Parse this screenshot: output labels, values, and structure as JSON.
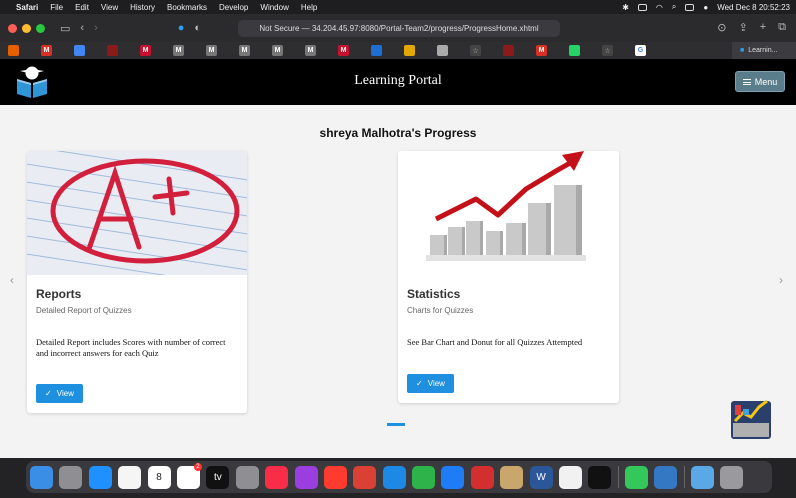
{
  "menubar": {
    "apple": "",
    "items": [
      "Safari",
      "File",
      "Edit",
      "View",
      "History",
      "Bookmarks",
      "Develop",
      "Window",
      "Help"
    ],
    "datetime": "Wed Dec 8  20:52:23"
  },
  "browser": {
    "address": "Not Secure — 34.204.45.97:8080/Portal-Team2/progress/ProgressHome.xhtml",
    "active_tab": "Learnin..."
  },
  "favorites": [
    {
      "icon": "firefox-icon",
      "color": "#e66000",
      "glyph": ""
    },
    {
      "icon": "gmail-icon",
      "color": "#d93025",
      "glyph": "M"
    },
    {
      "icon": "docs-icon",
      "color": "#4285f4",
      "glyph": ""
    },
    {
      "icon": "site-icon",
      "color": "#8b1a1a",
      "glyph": ""
    },
    {
      "icon": "mcgraw-icon",
      "color": "#c8102e",
      "glyph": "M"
    },
    {
      "icon": "m-icon",
      "color": "#777",
      "glyph": "M"
    },
    {
      "icon": "m-icon",
      "color": "#777",
      "glyph": "M"
    },
    {
      "icon": "m-icon",
      "color": "#777",
      "glyph": "M"
    },
    {
      "icon": "m-icon",
      "color": "#777",
      "glyph": "M"
    },
    {
      "icon": "m-icon",
      "color": "#777",
      "glyph": "M"
    },
    {
      "icon": "mcgraw-icon",
      "color": "#c8102e",
      "glyph": "M"
    },
    {
      "icon": "learn-icon",
      "color": "#1d6fd6",
      "glyph": ""
    },
    {
      "icon": "hazard-icon",
      "color": "#e0a800",
      "glyph": ""
    },
    {
      "icon": "tool-icon",
      "color": "#aaa",
      "glyph": ""
    },
    {
      "icon": "star-icon",
      "color": "#444",
      "glyph": "☆"
    },
    {
      "icon": "site-icon",
      "color": "#8b1a1a",
      "glyph": ""
    },
    {
      "icon": "gmail-icon",
      "color": "#d93025",
      "glyph": "M"
    },
    {
      "icon": "whatsapp-icon",
      "color": "#25d366",
      "glyph": ""
    },
    {
      "icon": "star-icon",
      "color": "#444",
      "glyph": "☆"
    },
    {
      "icon": "google-icon",
      "color": "#fff",
      "glyph": "G"
    }
  ],
  "page": {
    "brand": "Learning Portal",
    "menu_label": "Menu",
    "heading": "shreya Malhotra's Progress",
    "cards": [
      {
        "title": "Reports",
        "subtitle": "Detailed Report of Quizzes",
        "text": "Detailed Report includes Scores with number of correct and incorrect answers for each Quiz",
        "button": "View"
      },
      {
        "title": "Statistics",
        "subtitle": "Charts for Quizzes",
        "text": "See Bar Chart and Donut for all Quizzes Attempted",
        "button": "View"
      }
    ],
    "prev_arrow": "‹",
    "next_arrow": "›"
  },
  "dock": [
    {
      "icon": "finder-icon",
      "color": "#3a8ee6"
    },
    {
      "icon": "launchpad-icon",
      "color": "#8e8e93"
    },
    {
      "icon": "safari-icon",
      "color": "#1e90ff"
    },
    {
      "icon": "photos-icon",
      "color": "#f5f5f5"
    },
    {
      "icon": "calendar-icon",
      "color": "#ffffff",
      "label": "8"
    },
    {
      "icon": "reminders-icon",
      "color": "#ffffff",
      "badge": true
    },
    {
      "icon": "appletv-icon",
      "color": "#111",
      "label": "tv"
    },
    {
      "icon": "settings-icon",
      "color": "#8e8e93"
    },
    {
      "icon": "music-icon",
      "color": "#fa2d48"
    },
    {
      "icon": "podcasts-icon",
      "color": "#9b3ee0"
    },
    {
      "icon": "news-icon",
      "color": "#ff3b30"
    },
    {
      "icon": "todoist-icon",
      "color": "#db4035"
    },
    {
      "icon": "keynote-icon",
      "color": "#1e88e5"
    },
    {
      "icon": "numbers-icon",
      "color": "#2eb34a"
    },
    {
      "icon": "appstore-icon",
      "color": "#1e7cf5"
    },
    {
      "icon": "pdf-icon",
      "color": "#d32f2f"
    },
    {
      "icon": "preview-icon",
      "color": "#c9a66b"
    },
    {
      "icon": "word-icon",
      "color": "#2b579a",
      "label": "W"
    },
    {
      "icon": "chrome-icon",
      "color": "#f1f1f1"
    },
    {
      "icon": "terminal-icon",
      "color": "#111"
    },
    {
      "icon": "facetime-icon",
      "color": "#34c759"
    },
    {
      "icon": "contacts-icon",
      "color": "#3478c4"
    },
    {
      "icon": "folder-icon",
      "color": "#5aa9e6"
    },
    {
      "icon": "trash-icon",
      "color": "#9a9a9e"
    }
  ]
}
